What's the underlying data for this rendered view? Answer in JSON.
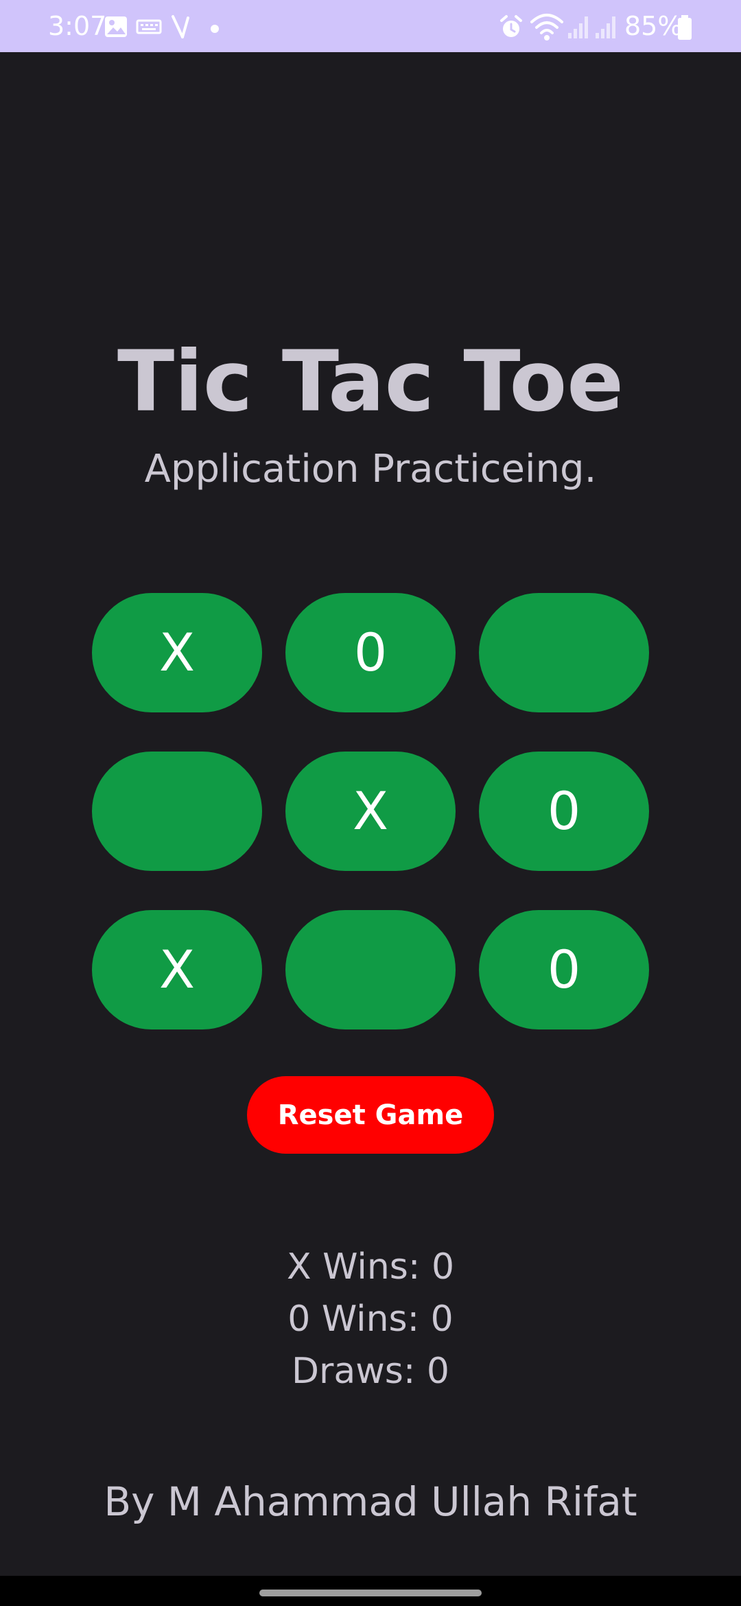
{
  "status_bar": {
    "time": "3:07",
    "battery": "85%",
    "icons": [
      "image-icon",
      "keyboard-icon",
      "phone-missed-icon",
      "dot-icon",
      "alarm-icon",
      "wifi-icon",
      "signal-icon",
      "signal-icon-2",
      "battery-icon"
    ],
    "background": "#d0c4fb"
  },
  "header": {
    "title": "Tic Tac Toe",
    "subtitle": "Application Practiceing."
  },
  "board": {
    "cells": [
      "X",
      "0",
      "",
      "",
      "X",
      "0",
      "X",
      "",
      "0"
    ],
    "cell_color": "#109b45"
  },
  "actions": {
    "reset_label": "Reset Game",
    "reset_color": "#ff0000"
  },
  "stats": {
    "x_wins": "X Wins: 0",
    "o_wins": "0 Wins: 0",
    "draws": "Draws: 0"
  },
  "footer": {
    "author": "By M Ahammad Ullah Rifat"
  },
  "colors": {
    "background": "#1c1b1f",
    "text": "#cbc7d2"
  }
}
